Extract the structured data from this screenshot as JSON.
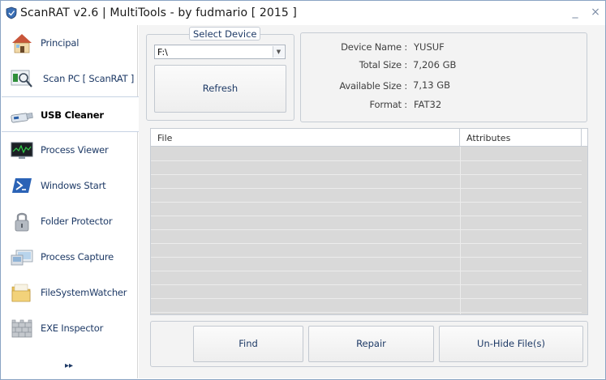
{
  "window": {
    "title": "ScanRAT v2.6 | MultiTools - by fudmario [ 2015 ]",
    "minimize_glyph": "_",
    "close_glyph": "×"
  },
  "sidebar": {
    "items": [
      {
        "label": "Principal",
        "icon": "house-icon"
      },
      {
        "label": "Scan PC [ ScanRAT ]",
        "icon": "magnifier-icon"
      },
      {
        "label": "USB Cleaner",
        "icon": "usb-drive-icon",
        "active": true
      },
      {
        "label": "Process Viewer",
        "icon": "monitor-chart-icon"
      },
      {
        "label": "Windows Start",
        "icon": "powershell-icon"
      },
      {
        "label": "Folder Protector",
        "icon": "padlock-icon"
      },
      {
        "label": "Process Capture",
        "icon": "screenshot-icon"
      },
      {
        "label": "FileSystemWatcher",
        "icon": "folder-icon"
      },
      {
        "label": "EXE Inspector",
        "icon": "wall-icon"
      }
    ],
    "more_glyph": "▸▸"
  },
  "device": {
    "group_label": "Select Device",
    "selected_drive": "F:\\",
    "refresh_label": "Refresh"
  },
  "info": {
    "name_key": "Device Name :",
    "name_val": "YUSUF",
    "total_key": "Total Size :",
    "total_val": "7,206 GB",
    "avail_key": "Available Size :",
    "avail_val": "7,13 GB",
    "format_key": "Format :",
    "format_val": "FAT32"
  },
  "table": {
    "columns": [
      "File",
      "Attributes"
    ],
    "rows": []
  },
  "actions": {
    "find_label": "Find",
    "repair_label": "Repair",
    "unhide_label": "Un-Hide File(s)"
  },
  "colors": {
    "accent": "#1e3a66",
    "panel_bg": "#f3f3f3",
    "grid_bg": "#d9d9d9"
  }
}
